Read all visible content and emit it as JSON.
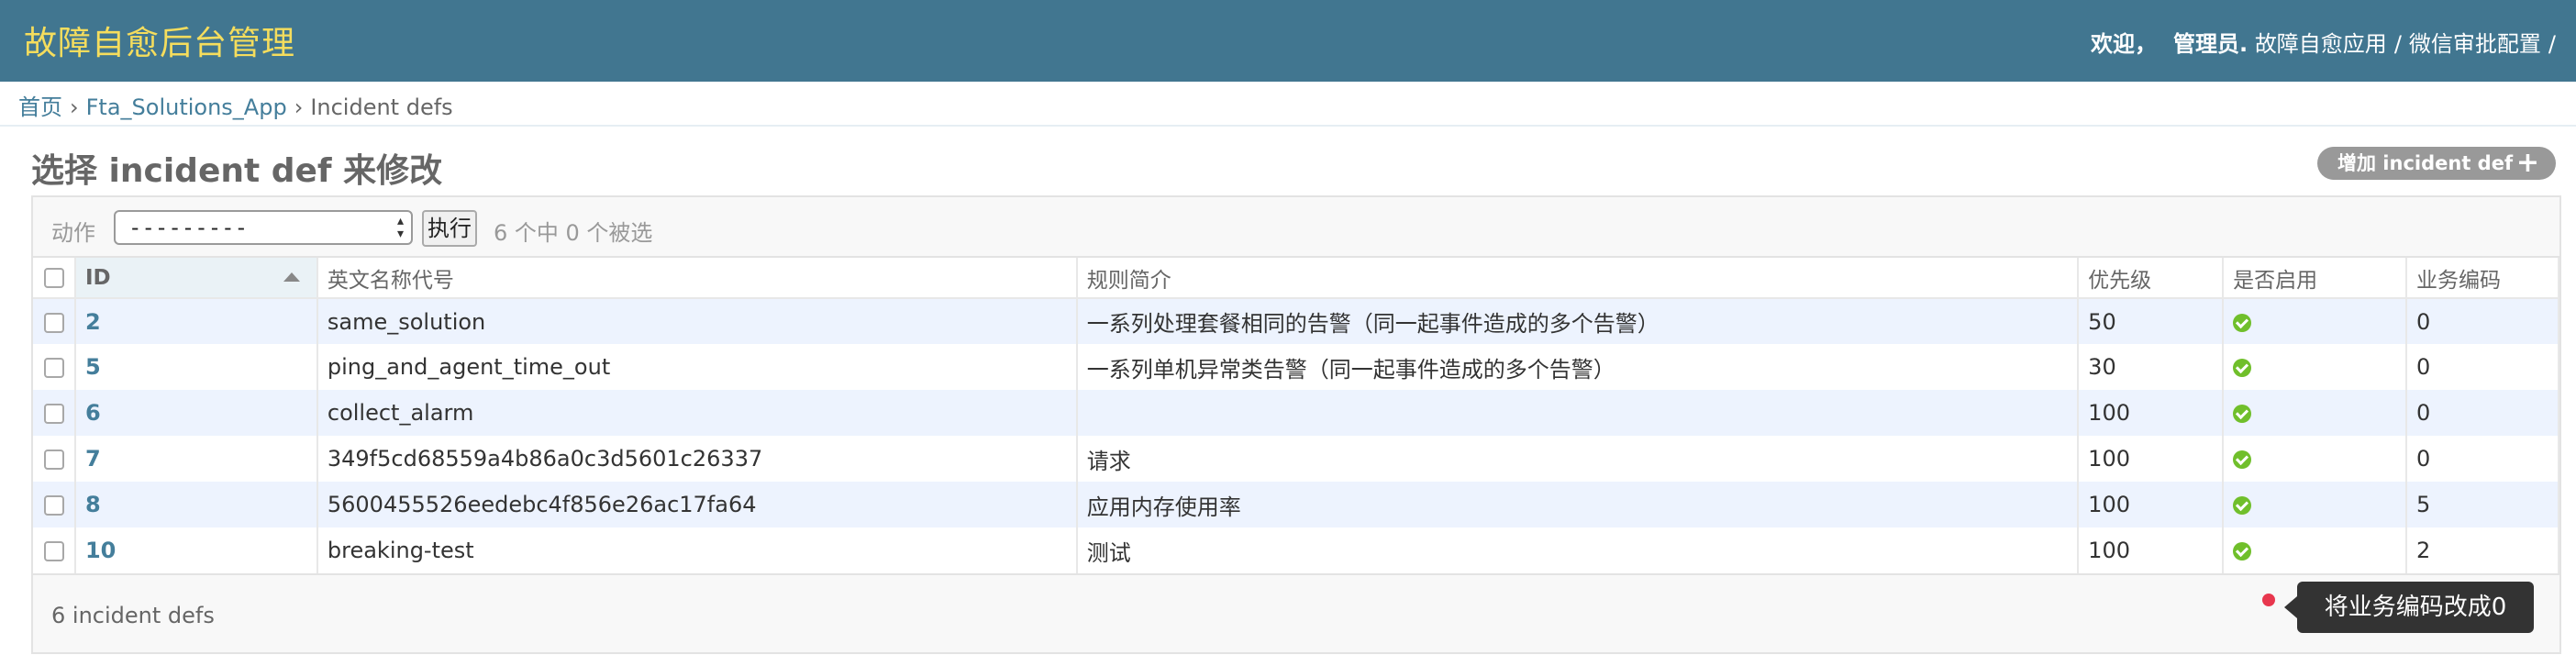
{
  "header": {
    "site_title": "故障自愈后台管理",
    "welcome": "欢迎，",
    "username": "管理员.",
    "links": [
      "故障自愈应用",
      "微信审批配置"
    ],
    "separator": "/"
  },
  "breadcrumbs": {
    "home": "首页",
    "app": "Fta_Solutions_App",
    "current": "Incident defs",
    "arrow": "›"
  },
  "page_title": "选择 incident def 来修改",
  "add_button": {
    "label": "增加 incident def",
    "plus": "+"
  },
  "actions": {
    "label": "动作",
    "selected_value": "---------",
    "go_label": "执行",
    "counter": "6 个中 0 个被选"
  },
  "table": {
    "headers": [
      "ID",
      "英文名称代号",
      "规则简介",
      "优先级",
      "是否启用",
      "业务编码"
    ],
    "rows": [
      {
        "id": "2",
        "name": "same_solution",
        "desc": "一系列处理套餐相同的告警（同一起事件造成的多个告警）",
        "priority": "50",
        "enabled": true,
        "biz": "0"
      },
      {
        "id": "5",
        "name": "ping_and_agent_time_out",
        "desc": "一系列单机异常类告警（同一起事件造成的多个告警）",
        "priority": "30",
        "enabled": true,
        "biz": "0"
      },
      {
        "id": "6",
        "name": "collect_alarm",
        "desc": "",
        "priority": "100",
        "enabled": true,
        "biz": "0"
      },
      {
        "id": "7",
        "name": "349f5cd68559a4b86a0c3d5601c26337",
        "desc": "请求",
        "priority": "100",
        "enabled": true,
        "biz": "0"
      },
      {
        "id": "8",
        "name": "5600455526eedebc4f856e26ac17fa64",
        "desc": "应用内存使用率",
        "priority": "100",
        "enabled": true,
        "biz": "5"
      },
      {
        "id": "10",
        "name": "breaking-test",
        "desc": "测试",
        "priority": "100",
        "enabled": true,
        "biz": "2"
      }
    ]
  },
  "paginator": {
    "count_text": "6 incident defs"
  },
  "tooltip": {
    "text": "将业务编码改成0"
  },
  "colors": {
    "header_bg": "#417690",
    "title_yellow": "#f5dd5d",
    "link_blue": "#447e9b",
    "row_alt": "#edf3fe",
    "yes_green": "#70bf2b",
    "tooltip_dot": "#e8374e"
  },
  "icons": {
    "sort": "sort-ascending-icon",
    "enabled": "check-circle-icon",
    "select": "select-caret-icon"
  }
}
